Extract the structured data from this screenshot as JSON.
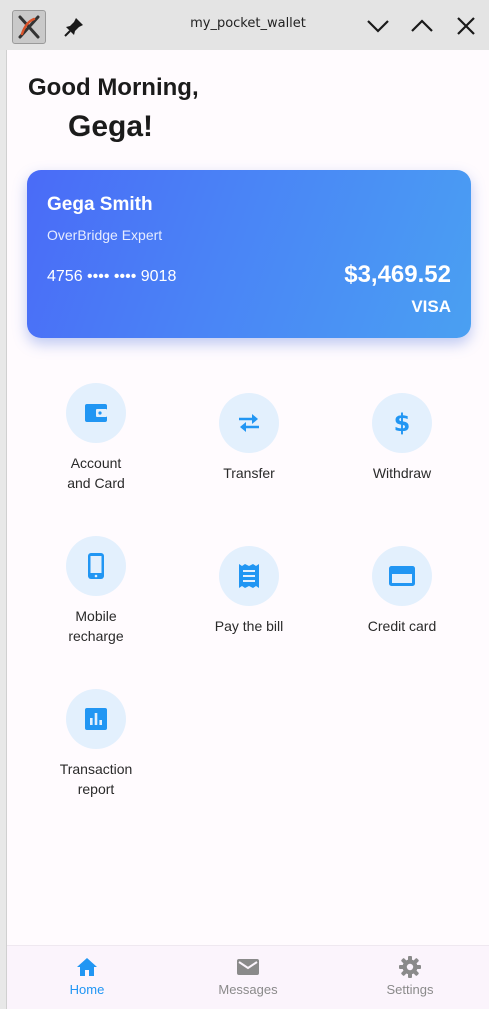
{
  "window": {
    "title": "my_pocket_wallet"
  },
  "header": {
    "greeting": "Good Morning,",
    "name": "Gega!"
  },
  "card": {
    "holder": "Gega Smith",
    "role": "OverBridge Expert",
    "number": "4756 •••• •••• 9018",
    "balance": "$3,469.52",
    "brand": "VISA",
    "gradient_start": "#4a6bf7",
    "gradient_end": "#4aa0f2"
  },
  "actions": [
    {
      "label": "Account\nand Card",
      "icon": "wallet-icon"
    },
    {
      "label": "Transfer",
      "icon": "swap-arrows-icon"
    },
    {
      "label": "Withdraw",
      "icon": "dollar-icon"
    },
    {
      "label": "Mobile\nrecharge",
      "icon": "smartphone-icon"
    },
    {
      "label": "Pay the bill",
      "icon": "receipt-icon"
    },
    {
      "label": "Credit card",
      "icon": "credit-card-icon"
    },
    {
      "label": "Transaction\nreport",
      "icon": "bar-chart-icon"
    }
  ],
  "bottom_nav": {
    "items": [
      {
        "label": "Home",
        "icon": "home-icon",
        "active": true
      },
      {
        "label": "Messages",
        "icon": "mail-icon",
        "active": false
      },
      {
        "label": "Settings",
        "icon": "gear-icon",
        "active": false
      }
    ]
  },
  "colors": {
    "accent": "#2196f3",
    "icon_bg": "#e3f0fd",
    "inactive": "#8a8a8a"
  }
}
